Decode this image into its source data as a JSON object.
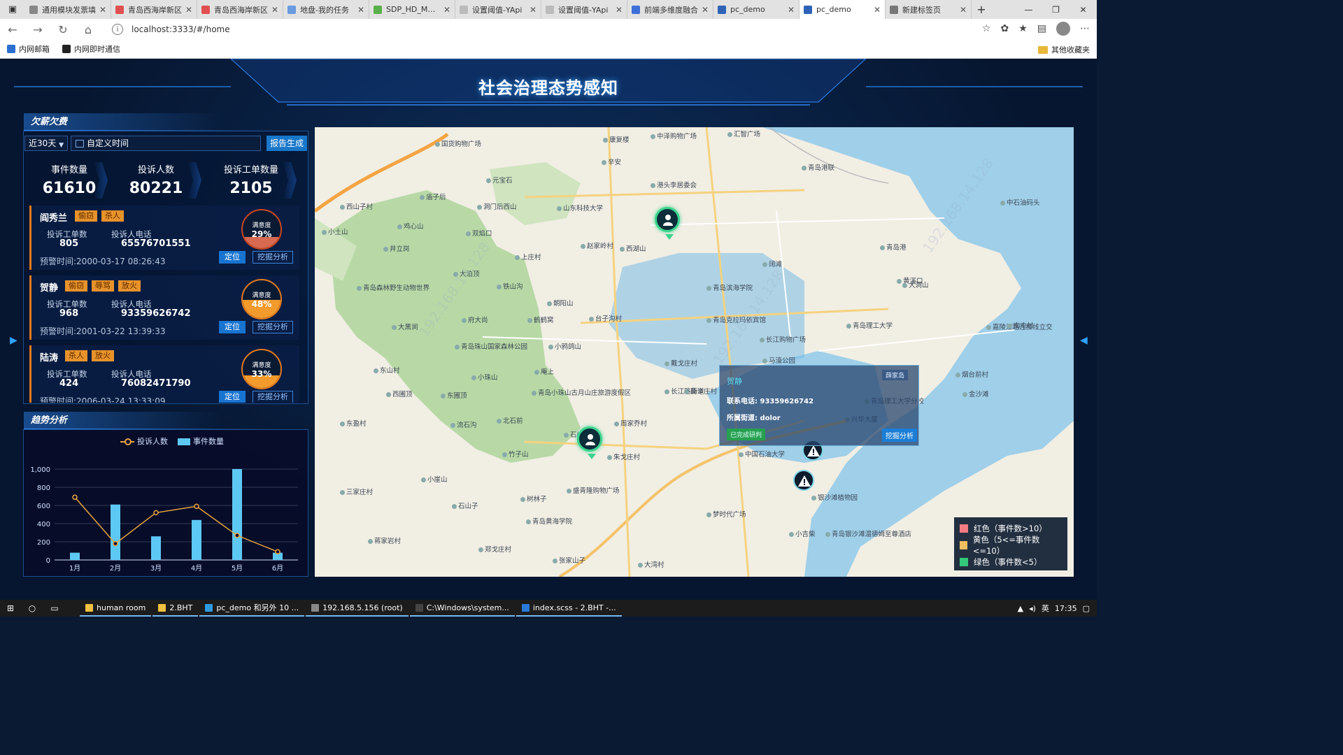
{
  "browser": {
    "tabs": [
      {
        "label": "通用模块发票填",
        "fav": "#888"
      },
      {
        "label": "青岛西海岸新区",
        "fav": "#e05050"
      },
      {
        "label": "青岛西海岸新区",
        "fav": "#e05050"
      },
      {
        "label": "地盘-我的任务",
        "fav": "#6a9ae0"
      },
      {
        "label": "SDP_HD_MDSS",
        "fav": "#5ab04a"
      },
      {
        "label": "设置阈值-YApi",
        "fav": "#bbb"
      },
      {
        "label": "设置阈值-YApi",
        "fav": "#bbb"
      },
      {
        "label": "前端多维度融合",
        "fav": "#3f6fd8"
      },
      {
        "label": "pc_demo",
        "fav": "#2e63b8"
      },
      {
        "label": "pc_demo",
        "fav": "#2e63b8"
      },
      {
        "label": "新建标签页",
        "fav": "#777"
      }
    ],
    "url": "localhost:3333/#/home",
    "bookmarks": [
      {
        "label": "内网邮箱",
        "color": "#2a6fd0"
      },
      {
        "label": "内网即时通信",
        "color": "#222"
      }
    ],
    "other_bookmarks": "其他收藏夹"
  },
  "app": {
    "title": "社会治理态势感知",
    "panel1_title": "欠薪欠费",
    "panel2_title": "趋势分析",
    "filter": {
      "range": "近30天",
      "date_placeholder": "自定义时间",
      "report_button": "报告生成"
    },
    "stats": [
      {
        "label": "事件数量",
        "value": "61610"
      },
      {
        "label": "投诉人数",
        "value": "80221"
      },
      {
        "label": "投诉工单数量",
        "value": "2105"
      }
    ],
    "labels": {
      "orders": "投诉工单数",
      "phone": "投诉人电话",
      "warn_prefix": "预警时间:",
      "satisfaction": "满意度",
      "locate": "定位",
      "mine": "挖掘分析"
    },
    "alerts": [
      {
        "name": "阎秀兰",
        "tags": [
          "偷窃",
          "杀人"
        ],
        "orders": "805",
        "phone": "65576701551",
        "warn_time": "2000-03-17 08:26:43",
        "satisfaction": "29%",
        "sat_value": 29
      },
      {
        "name": "贺静",
        "tags": [
          "偷窃",
          "辱骂",
          "放火"
        ],
        "orders": "968",
        "phone": "93359626742",
        "warn_time": "2001-03-22 13:39:33",
        "satisfaction": "48%",
        "sat_value": 48
      },
      {
        "name": "陆涛",
        "tags": [
          "杀人",
          "放火"
        ],
        "orders": "424",
        "phone": "76082471790",
        "warn_time": "2006-03-24 13:33:09",
        "satisfaction": "33%",
        "sat_value": 33
      }
    ]
  },
  "chart_data": {
    "type": "bar",
    "categories": [
      "1月",
      "2月",
      "3月",
      "4月",
      "5月",
      "6月"
    ],
    "series": [
      {
        "name": "投诉人数",
        "type": "line",
        "values": [
          690,
          180,
          520,
          590,
          270,
          90
        ],
        "color": "#e8a53c"
      },
      {
        "name": "事件数量",
        "type": "bar",
        "values": [
          80,
          610,
          260,
          440,
          1000,
          80
        ],
        "color": "#5ec8f5"
      }
    ],
    "yticks": [
      "0",
      "200",
      "400",
      "600",
      "800",
      "1,000"
    ],
    "ylim": [
      0,
      1000
    ]
  },
  "map": {
    "labels": [
      "国货购物广场",
      "康复楼",
      "中泽购物广场",
      "汇智广场",
      "元宝石",
      "辛安",
      "青岛港联",
      "港头李居委会",
      "西山子村",
      "庙子后",
      "洞门后西山",
      "山东科技大学",
      "中石油码头",
      "井立岗",
      "小土山",
      "鸡心山",
      "双焰口",
      "赵家岭村",
      "西湖山",
      "青岛港",
      "上庄村",
      "大泊顶",
      "阔滩",
      "黄溪口",
      "青岛森林野生动物世界",
      "铁山沟",
      "朝阳山",
      "青岛滨海学院",
      "大洞山",
      "青岛理工大学",
      "台子沟村",
      "青岛克拉玛依宾馆",
      "大黑涧",
      "府大尚",
      "鹤鹤窝",
      "长江购物广场",
      "小鸦鸽山",
      "青岛珠山国家森林公园",
      "戴戈庄村",
      "马濠公园",
      "长江路街道",
      "东山村",
      "庵上",
      "小珠山",
      "西圃顶",
      "东圃顶",
      "青岛小珠山古月山庄旅游度假区",
      "薛辛庄村",
      "青岛理工大学分校",
      "兴华大厦",
      "流石沟",
      "北石前",
      "东盈村",
      "竹子山",
      "石岭",
      "周家乔村",
      "中国石油大学",
      "朱戈庄村",
      "小崖山",
      "盛青隆购物广场",
      "三家庄村",
      "石山子",
      "树林子",
      "银沙滩植物园",
      "青岛黄海学院",
      "梦时代广场",
      "蒋家岩村",
      "郑戈庄村",
      "张家山子",
      "大湾村",
      "小吉柴",
      "青岛银沙滩温德姆至尊酒店",
      "嘉陵江路连接线立交",
      "金沙滩",
      "烟台前村",
      "南屯村"
    ],
    "popup": {
      "title": "贺静",
      "phone_label": "联系电话:",
      "phone": "93359626742",
      "street_label": "所属街道:",
      "street": "dolor",
      "tag": "薛家岛",
      "left_button": "已完成研判",
      "button": "挖掘分析"
    },
    "legend": [
      {
        "label": "红色（事件数>10）",
        "color": "#f27a83"
      },
      {
        "label": "黄色（5<=事件数<=10）",
        "color": "#f0bd60"
      },
      {
        "label": "绿色（事件数<5）",
        "color": "#33c87a"
      }
    ]
  },
  "taskbar": {
    "items": [
      {
        "label": "human room",
        "color": "#f0c040"
      },
      {
        "label": "2.BHT",
        "color": "#f0c040"
      },
      {
        "label": "pc_demo 和另外 10 ...",
        "color": "#2e9ae0"
      },
      {
        "label": "192.168.5.156 (root)",
        "color": "#888"
      },
      {
        "label": "C:\\Windows\\system...",
        "color": "#444"
      },
      {
        "label": "index.scss - 2.BHT -...",
        "color": "#2a7ad8"
      }
    ],
    "ime": "英",
    "time": "17:35"
  }
}
